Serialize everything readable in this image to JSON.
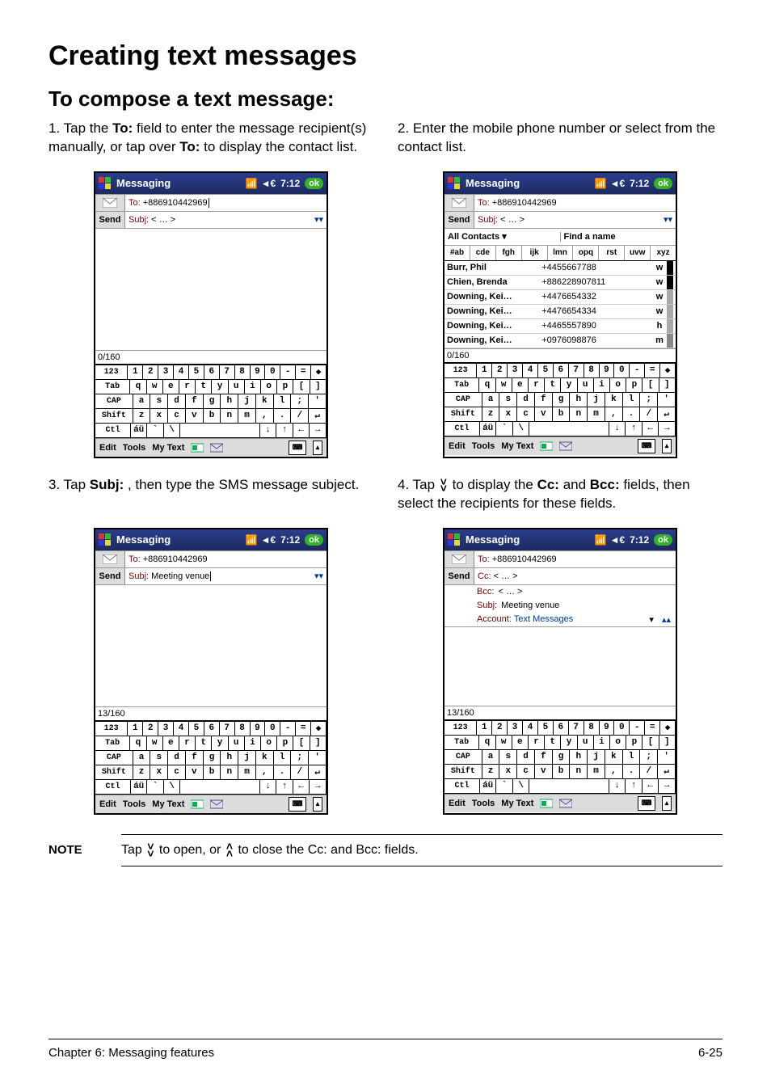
{
  "heading": "Creating text messages",
  "subheading": "To compose a text message:",
  "steps": {
    "s1": {
      "num": "1.",
      "pre": "Tap the ",
      "b1": "To:",
      "mid": " field to enter the message recipient(s) manually, or tap over ",
      "b2": "To:",
      "post": " to display the contact list."
    },
    "s2": {
      "num": "2.",
      "text": "Enter the mobile phone number or select from the contact list."
    },
    "s3": {
      "num": "3.",
      "pre": "Tap ",
      "b1": "Subj:",
      "post": " , then type the SMS message subject."
    },
    "s4": {
      "num": "4.",
      "pre": "Tap ",
      "mid": " to display the ",
      "b1": "Cc:",
      "and": " and ",
      "b2": "Bcc:",
      "post": " fields, then select the recipients for these fields."
    }
  },
  "shot_common": {
    "title": "Messaging",
    "clock": "7:12",
    "ok": "ok",
    "signal": "◄€",
    "menubar": {
      "edit": "Edit",
      "tools": "Tools",
      "mytext": "My Text"
    }
  },
  "shot1": {
    "to_label": "To:",
    "to_val": "+886910442969",
    "send": "Send",
    "subj_label": "Subj:",
    "subj_val": "< … >",
    "counter": "0/160"
  },
  "shot2": {
    "to_label": "To:",
    "to_val": "+886910442969",
    "send": "Send",
    "subj_label": "Subj:",
    "subj_val": "< … >",
    "all_contacts": "All Contacts",
    "find": "Find a name",
    "tabs": [
      "#ab",
      "cde",
      "fgh",
      "ijk",
      "lmn",
      "opq",
      "rst",
      "uvw",
      "xyz"
    ],
    "contacts": [
      {
        "name": "Burr, Phil",
        "num": "+4455667788",
        "type": "w"
      },
      {
        "name": "Chien, Brenda",
        "num": "+886228907811",
        "type": "w"
      },
      {
        "name": "Downing, Kei…",
        "num": "+4476654332",
        "type": "w"
      },
      {
        "name": "Downing, Kei…",
        "num": "+4476654334",
        "type": "w"
      },
      {
        "name": "Downing, Kei…",
        "num": "+4465557890",
        "type": "h"
      },
      {
        "name": "Downing, Kei…",
        "num": "+0976098876",
        "type": "m"
      }
    ],
    "counter": "0/160"
  },
  "shot3": {
    "to_label": "To:",
    "to_val": "+886910442969",
    "send": "Send",
    "subj_label": "Subj:",
    "subj_val": "Meeting venue",
    "counter": "13/160"
  },
  "shot4": {
    "to_label": "To:",
    "to_val": "+886910442969",
    "send": "Send",
    "cc_label": "Cc:",
    "cc_val": "< … >",
    "bcc_label": "Bcc:",
    "bcc_val": "< … >",
    "subj_label": "Subj:",
    "subj_val": "Meeting venue",
    "acct_label": "Account:",
    "acct_val": "Text Messages",
    "counter": "13/160"
  },
  "keyboard": {
    "r1": [
      "123",
      "1",
      "2",
      "3",
      "4",
      "5",
      "6",
      "7",
      "8",
      "9",
      "0",
      "-",
      "=",
      "◆"
    ],
    "r2": [
      "Tab",
      "q",
      "w",
      "e",
      "r",
      "t",
      "y",
      "u",
      "i",
      "o",
      "p",
      "[",
      "]"
    ],
    "r3": [
      "CAP",
      "a",
      "s",
      "d",
      "f",
      "g",
      "h",
      "j",
      "k",
      "l",
      ";",
      "'"
    ],
    "r4": [
      "Shift",
      "z",
      "x",
      "c",
      "v",
      "b",
      "n",
      "m",
      ",",
      ".",
      "/",
      "↵"
    ],
    "r5": [
      "Ctl",
      "áü",
      "`",
      "\\",
      " ",
      "↓",
      "↑",
      "←",
      "→"
    ]
  },
  "note": {
    "label": "NOTE",
    "pre": "Tap ",
    "mid": " to open, or ",
    "post": " to close the Cc: and Bcc: fields."
  },
  "footer": {
    "left": "Chapter 6: Messaging features",
    "right": "6-25"
  }
}
